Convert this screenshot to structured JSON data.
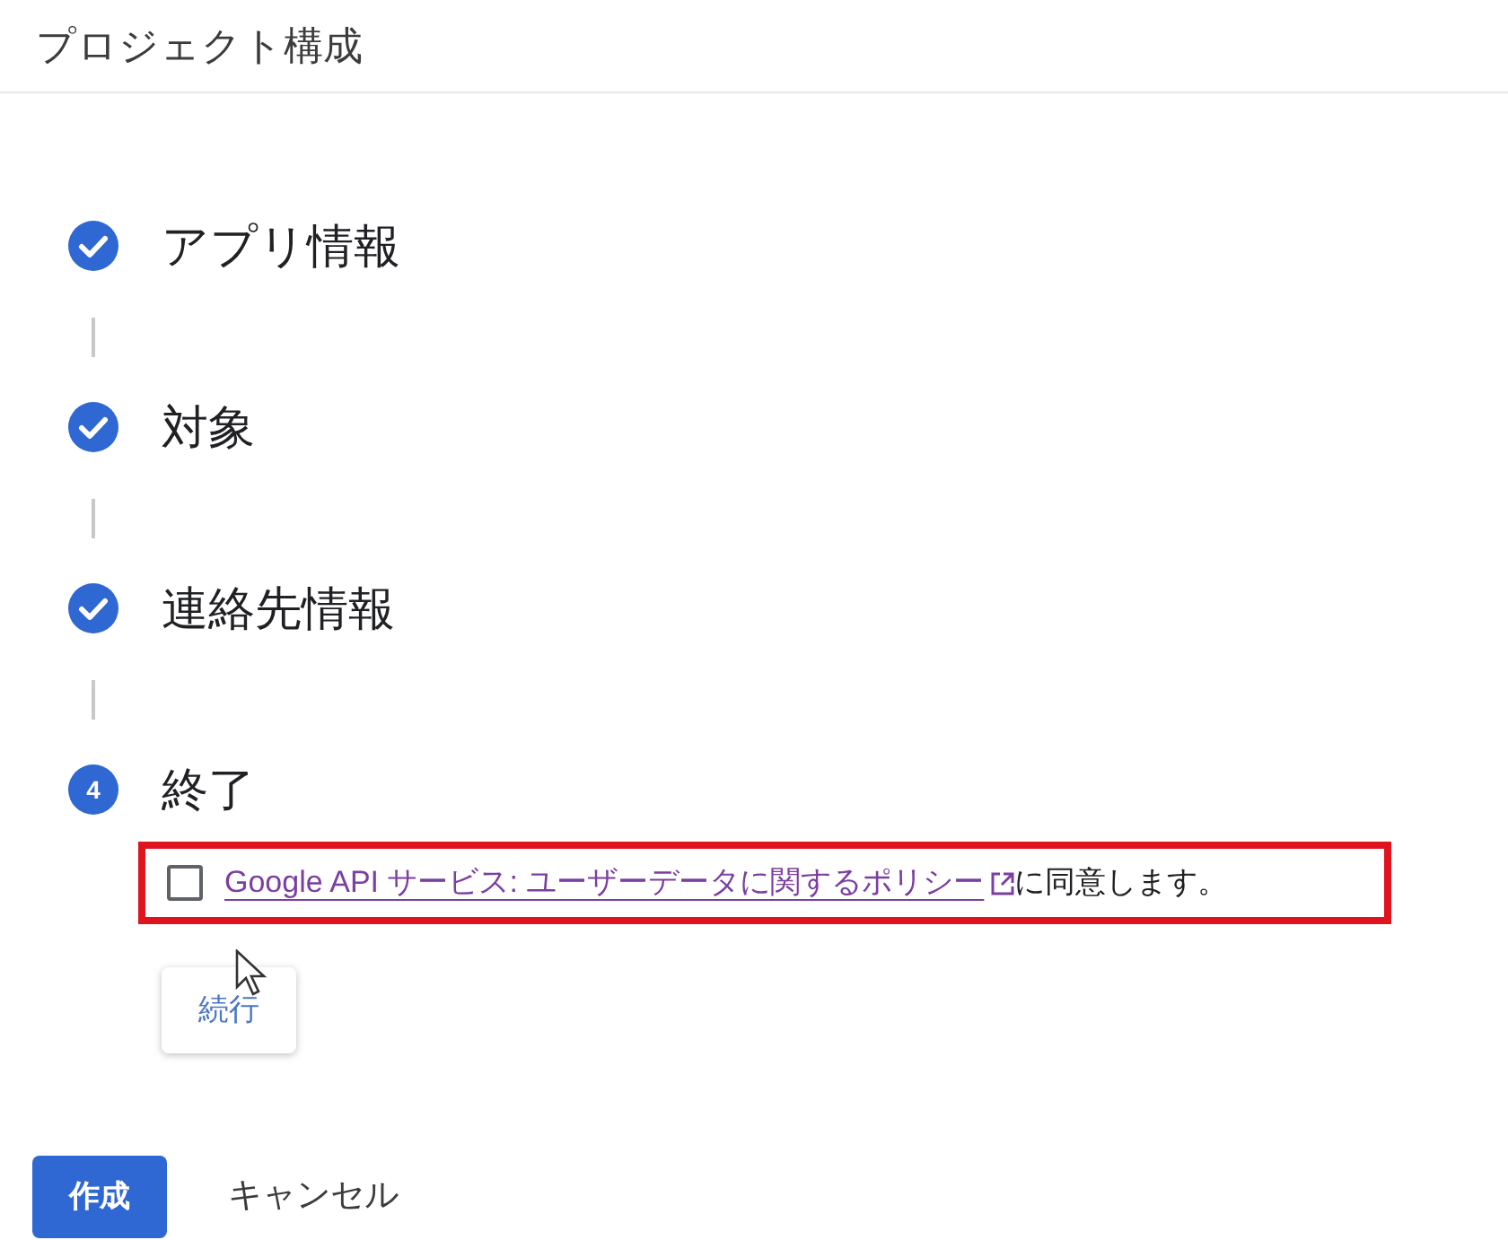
{
  "title": "プロジェクト構成",
  "steps": [
    {
      "kind": "done",
      "label": "アプリ情報"
    },
    {
      "kind": "done",
      "label": "対象"
    },
    {
      "kind": "done",
      "label": "連絡先情報"
    },
    {
      "kind": "number",
      "number": "4",
      "label": "終了"
    }
  ],
  "agreement": {
    "checked": false,
    "link": "Google API サービス: ユーザーデータに関するポリシー",
    "suffix": "に同意します。",
    "highlighted": true
  },
  "continue_button": "続行",
  "footer": {
    "create_button": "作成",
    "cancel_button": "キャンセル"
  }
}
